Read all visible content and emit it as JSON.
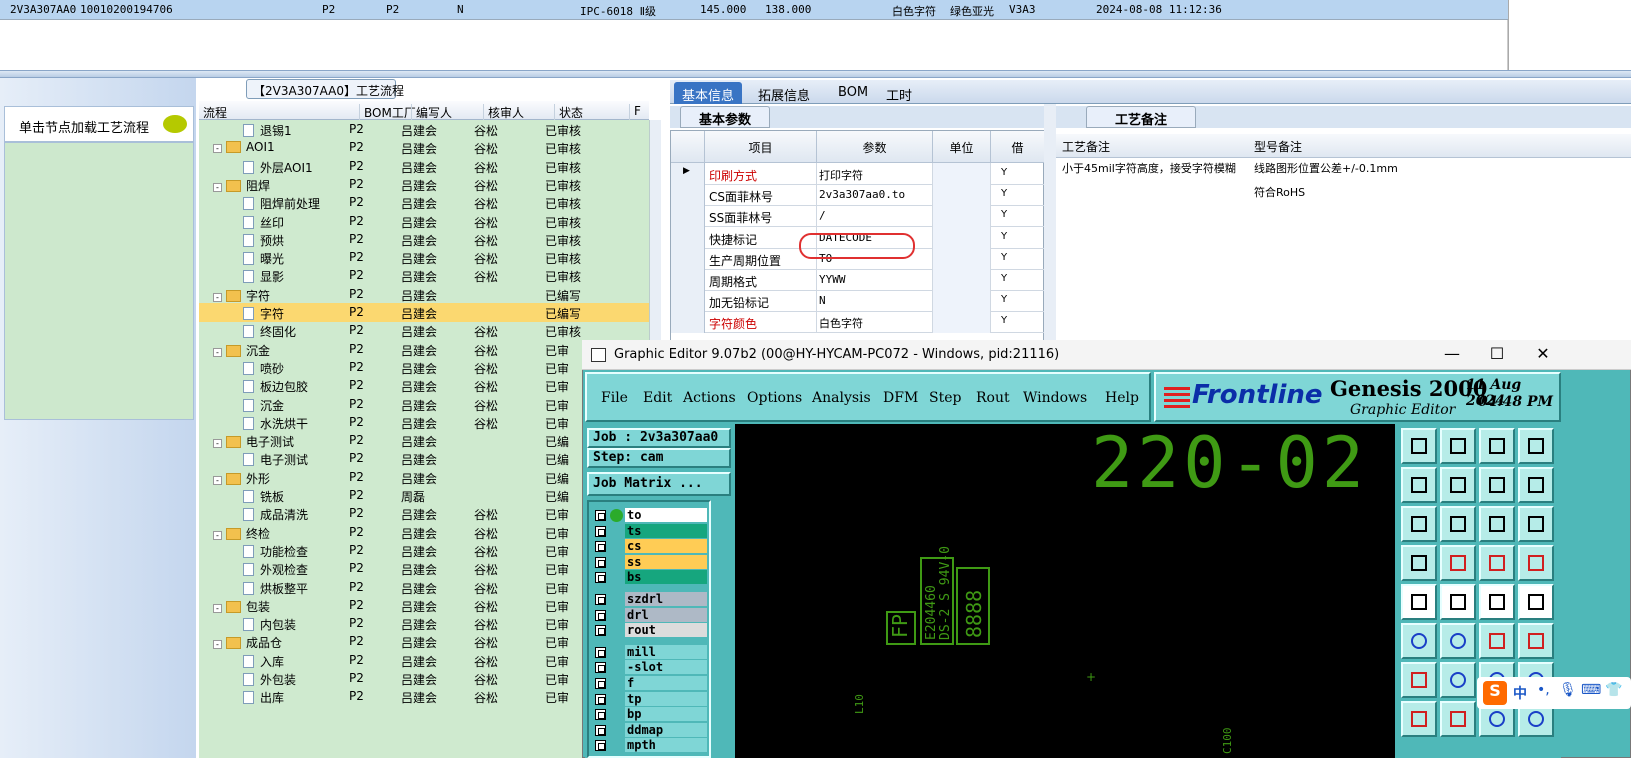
{
  "top_row": {
    "id": "2V3A307AA0",
    "code": "10010200194706",
    "a": "P2",
    "b": "P2",
    "c": "N",
    "grade": "IPC-6018 Ⅱ级",
    "v1": "145.000",
    "v2": "138.000",
    "char_color": "白色字符",
    "mask_color": "绿色亚光",
    "rev": "V3A3",
    "datetime": "2024-08-08 11:12:36"
  },
  "left": {
    "load_text": "单击节点加载工艺流程"
  },
  "tree": {
    "title": "【2V3A307AA0】工艺流程",
    "headers": [
      "流程",
      "BOM工厂",
      "编写人",
      "核审人",
      "状态",
      "F"
    ],
    "rows": [
      {
        "type": "file",
        "level": 2,
        "name": "退锡1",
        "bom": "P2",
        "writer": "吕建会",
        "reviewer": "谷松",
        "status": "已审核"
      },
      {
        "type": "folder",
        "level": 1,
        "name": "AOI1",
        "bom": "P2",
        "writer": "吕建会",
        "reviewer": "谷松",
        "status": "已审核"
      },
      {
        "type": "file",
        "level": 2,
        "name": "外层AOI1",
        "bom": "P2",
        "writer": "吕建会",
        "reviewer": "谷松",
        "status": "已审核"
      },
      {
        "type": "folder",
        "level": 1,
        "name": "阻焊",
        "bom": "P2",
        "writer": "吕建会",
        "reviewer": "谷松",
        "status": "已审核"
      },
      {
        "type": "file",
        "level": 2,
        "name": "阻焊前处理",
        "bom": "P2",
        "writer": "吕建会",
        "reviewer": "谷松",
        "status": "已审核"
      },
      {
        "type": "file",
        "level": 2,
        "name": "丝印",
        "bom": "P2",
        "writer": "吕建会",
        "reviewer": "谷松",
        "status": "已审核"
      },
      {
        "type": "file",
        "level": 2,
        "name": "预烘",
        "bom": "P2",
        "writer": "吕建会",
        "reviewer": "谷松",
        "status": "已审核"
      },
      {
        "type": "file",
        "level": 2,
        "name": "曝光",
        "bom": "P2",
        "writer": "吕建会",
        "reviewer": "谷松",
        "status": "已审核"
      },
      {
        "type": "file",
        "level": 2,
        "name": "显影",
        "bom": "P2",
        "writer": "吕建会",
        "reviewer": "谷松",
        "status": "已审核"
      },
      {
        "type": "folder",
        "level": 1,
        "name": "字符",
        "bom": "P2",
        "writer": "吕建会",
        "reviewer": "",
        "status": "已编写"
      },
      {
        "type": "file",
        "level": 2,
        "name": "字符",
        "bom": "P2",
        "writer": "吕建会",
        "reviewer": "",
        "status": "已编写",
        "selected": true
      },
      {
        "type": "file",
        "level": 2,
        "name": "终固化",
        "bom": "P2",
        "writer": "吕建会",
        "reviewer": "谷松",
        "status": "已审核"
      },
      {
        "type": "folder",
        "level": 1,
        "name": "沉金",
        "bom": "P2",
        "writer": "吕建会",
        "reviewer": "谷松",
        "status": "已审"
      },
      {
        "type": "file",
        "level": 2,
        "name": "喷砂",
        "bom": "P2",
        "writer": "吕建会",
        "reviewer": "谷松",
        "status": "已审"
      },
      {
        "type": "file",
        "level": 2,
        "name": "板边包胶",
        "bom": "P2",
        "writer": "吕建会",
        "reviewer": "谷松",
        "status": "已审"
      },
      {
        "type": "file",
        "level": 2,
        "name": "沉金",
        "bom": "P2",
        "writer": "吕建会",
        "reviewer": "谷松",
        "status": "已审"
      },
      {
        "type": "file",
        "level": 2,
        "name": "水洗烘干",
        "bom": "P2",
        "writer": "吕建会",
        "reviewer": "谷松",
        "status": "已审"
      },
      {
        "type": "folder",
        "level": 1,
        "name": "电子测试",
        "bom": "P2",
        "writer": "吕建会",
        "reviewer": "",
        "status": "已编"
      },
      {
        "type": "file",
        "level": 2,
        "name": "电子测试",
        "bom": "P2",
        "writer": "吕建会",
        "reviewer": "",
        "status": "已编"
      },
      {
        "type": "folder",
        "level": 1,
        "name": "外形",
        "bom": "P2",
        "writer": "吕建会",
        "reviewer": "",
        "status": "已编"
      },
      {
        "type": "file",
        "level": 2,
        "name": "铣板",
        "bom": "P2",
        "writer": "周磊",
        "reviewer": "",
        "status": "已编"
      },
      {
        "type": "file",
        "level": 2,
        "name": "成品清洗",
        "bom": "P2",
        "writer": "吕建会",
        "reviewer": "谷松",
        "status": "已审"
      },
      {
        "type": "folder",
        "level": 1,
        "name": "终检",
        "bom": "P2",
        "writer": "吕建会",
        "reviewer": "谷松",
        "status": "已审"
      },
      {
        "type": "file",
        "level": 2,
        "name": "功能检查",
        "bom": "P2",
        "writer": "吕建会",
        "reviewer": "谷松",
        "status": "已审"
      },
      {
        "type": "file",
        "level": 2,
        "name": "外观检查",
        "bom": "P2",
        "writer": "吕建会",
        "reviewer": "谷松",
        "status": "已审"
      },
      {
        "type": "file",
        "level": 2,
        "name": "烘板整平",
        "bom": "P2",
        "writer": "吕建会",
        "reviewer": "谷松",
        "status": "已审"
      },
      {
        "type": "folder",
        "level": 1,
        "name": "包装",
        "bom": "P2",
        "writer": "吕建会",
        "reviewer": "谷松",
        "status": "已审"
      },
      {
        "type": "file",
        "level": 2,
        "name": "内包装",
        "bom": "P2",
        "writer": "吕建会",
        "reviewer": "谷松",
        "status": "已审"
      },
      {
        "type": "folder",
        "level": 1,
        "name": "成品仓",
        "bom": "P2",
        "writer": "吕建会",
        "reviewer": "谷松",
        "status": "已审"
      },
      {
        "type": "file",
        "level": 2,
        "name": "入库",
        "bom": "P2",
        "writer": "吕建会",
        "reviewer": "谷松",
        "status": "已审"
      },
      {
        "type": "file",
        "level": 2,
        "name": "外包装",
        "bom": "P2",
        "writer": "吕建会",
        "reviewer": "谷松",
        "status": "已审"
      },
      {
        "type": "file",
        "level": 2,
        "name": "出库",
        "bom": "P2",
        "writer": "吕建会",
        "reviewer": "谷松",
        "status": "已审"
      }
    ]
  },
  "tabs": [
    "基本信息",
    "拓展信息",
    "BOM",
    "工时"
  ],
  "basic": {
    "tab": "基本参数",
    "headers": [
      "项目",
      "参数",
      "单位",
      "借"
    ],
    "rows": [
      {
        "key": "印刷方式",
        "value": "打印字符",
        "flag": "Y",
        "red": true,
        "current": true
      },
      {
        "key": "CS面菲林号",
        "value": "2v3a307aa0.to",
        "flag": "Y"
      },
      {
        "key": "SS面菲林号",
        "value": "/",
        "flag": "Y"
      },
      {
        "key": "快捷标记",
        "value": "DATECODE",
        "flag": "Y"
      },
      {
        "key": "生产周期位置",
        "value": "TO",
        "flag": "Y"
      },
      {
        "key": "周期格式",
        "value": "YYWW",
        "flag": "Y"
      },
      {
        "key": "加无铅标记",
        "value": "N",
        "flag": "Y"
      },
      {
        "key": "字符颜色",
        "value": "白色字符",
        "flag": "Y",
        "red": true
      }
    ]
  },
  "remarks": {
    "tab": "工艺备注",
    "headers": [
      "工艺备注",
      "型号备注"
    ],
    "process_note": "小于45mil字符高度，接受字符模糊",
    "model_note_1": "线路图形位置公差+/-0.1mm",
    "model_note_2": "符合RoHS"
  },
  "genesis": {
    "title": "Graphic Editor 9.07b2 (00@HY-HYCAM-PC072 - Windows, pid:21116)",
    "menu": [
      "File",
      "Edit",
      "Actions",
      "Options",
      "Analysis",
      "DFM",
      "Step",
      "Rout",
      "Windows",
      "Help"
    ],
    "brand": "Frontline",
    "product": "Genesis 2000",
    "subtitle": "Graphic Editor",
    "date": "11 Aug 2024",
    "time": "04:48 PM",
    "job": "Job : 2v3a307aa0",
    "step": "Step: cam",
    "job_matrix": "Job Matrix ...",
    "layers": [
      {
        "name": "to",
        "color": "#ffffff",
        "active": true
      },
      {
        "name": "ts",
        "color": "#16a67e"
      },
      {
        "name": "cs",
        "color": "#ffcc55"
      },
      {
        "name": "ss",
        "color": "#ffcc55"
      },
      {
        "name": "bs",
        "color": "#16a67e"
      },
      {
        "name": "szdrl",
        "color": "#aeb9c6"
      },
      {
        "name": "drl",
        "color": "#aeb9c6"
      },
      {
        "name": "rout",
        "color": "#dcdcdc"
      },
      {
        "name": "mill",
        "color": "#7fd6d6"
      },
      {
        "name": "-slot",
        "color": "#7fd6d6"
      },
      {
        "name": "f",
        "color": "#7fd6d6"
      },
      {
        "name": "tp",
        "color": "#7fd6d6"
      },
      {
        "name": "bp",
        "color": "#7fd6d6"
      },
      {
        "name": "ddmap",
        "color": "#7fd6d6"
      },
      {
        "name": "mpth",
        "color": "#7fd6d6"
      }
    ],
    "canvas_text": "220-02",
    "canvas_small": [
      "FP",
      "E204460",
      "DS-2 S 94V-0",
      "8888",
      "L10",
      "C100"
    ]
  },
  "ime": {
    "logo": "S",
    "lang": "中"
  }
}
